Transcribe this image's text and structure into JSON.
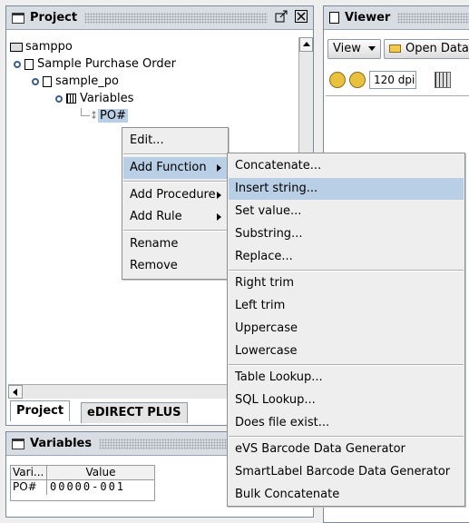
{
  "project_panel": {
    "title": "Project",
    "tree": {
      "root": "samppo",
      "document": "Sample Purchase Order",
      "file": "sample_po",
      "variables": "Variables",
      "selected": "PO#"
    },
    "tabs": [
      "Project",
      "eDIRECT PLUS"
    ]
  },
  "viewer_panel": {
    "title": "Viewer",
    "view_menu": "View",
    "open_button": "Open Data",
    "dpi": "120 dpi"
  },
  "variables_panel": {
    "title": "Variables",
    "headers": [
      "Vari...",
      "Value"
    ],
    "row": {
      "name": "PO#",
      "value": "00000-001"
    }
  },
  "context_menu": {
    "items": [
      "Edit...",
      "Add Function",
      "Add Procedure",
      "Add Rule",
      "Rename",
      "Remove"
    ]
  },
  "function_submenu": {
    "items": [
      "Concatenate...",
      "Insert string...",
      "Set value...",
      "Substring...",
      "Replace...",
      "Right trim",
      "Left trim",
      "Uppercase",
      "Lowercase",
      "Table Lookup...",
      "SQL Lookup...",
      "Does file exist...",
      "eVS Barcode Data Generator",
      "SmartLabel Barcode Data Generator",
      "Bulk Concatenate"
    ]
  },
  "colors": {
    "highlight": "#b8cfe5",
    "selected_node": "#b8cfe5",
    "panel_title": "#d8dde4"
  }
}
